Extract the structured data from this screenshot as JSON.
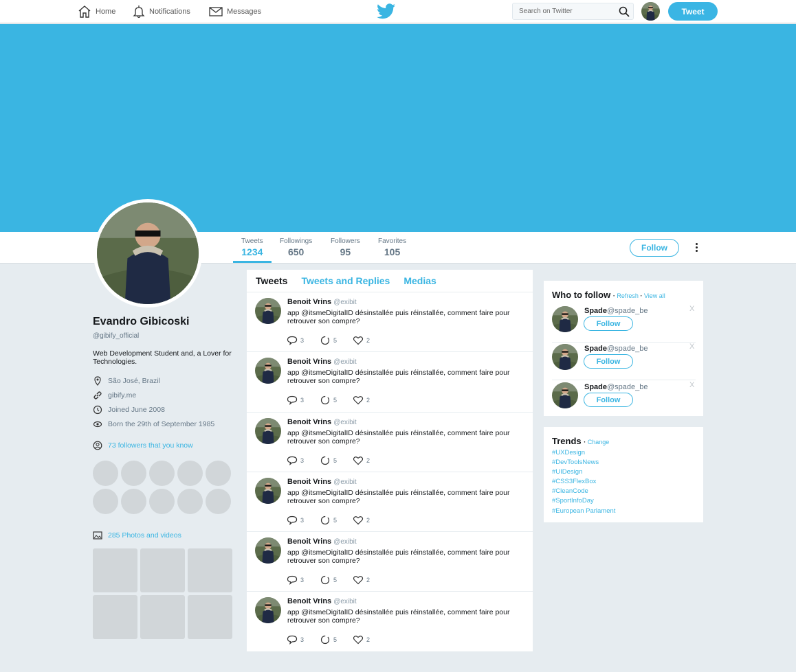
{
  "nav": {
    "home": "Home",
    "notifications": "Notifications",
    "messages": "Messages",
    "search_placeholder": "Search on Twitter",
    "tweet_button": "Tweet"
  },
  "profile_nav": {
    "stats": [
      {
        "label": "Tweets",
        "value": "1234"
      },
      {
        "label": "Followings",
        "value": "650"
      },
      {
        "label": "Followers",
        "value": "95"
      },
      {
        "label": "Favorites",
        "value": "105"
      }
    ],
    "follow_button": "Follow"
  },
  "profile": {
    "name": "Evandro Gibicoski",
    "handle": "@gibify_official",
    "bio": "Web Development Student and, a Lover for Technologies.",
    "location": "São José, Brazil",
    "website": "gibify.me",
    "joined": "Joined June 2008",
    "born": "Born the 29th of September 1985",
    "followers_you_know": "73 followers that you know",
    "photos_videos": "285 Photos and videos"
  },
  "timeline": {
    "tabs": [
      "Tweets",
      "Tweets and Replies",
      "Medias"
    ],
    "tweets": [
      {
        "author": "Benoit Vrins",
        "handle": "@exibit",
        "text": "app @itsmeDigitalID désinstallée puis réinstallée, comment faire pour retrouver son compre?",
        "replies": "3",
        "retweets": "5",
        "likes": "2"
      },
      {
        "author": "Benoit Vrins",
        "handle": "@exibit",
        "text": "app @itsmeDigitalID désinstallée puis réinstallée, comment faire pour retrouver son compre?",
        "replies": "3",
        "retweets": "5",
        "likes": "2"
      },
      {
        "author": "Benoit Vrins",
        "handle": "@exibit",
        "text": "app @itsmeDigitalID désinstallée puis réinstallée, comment faire pour retrouver son compre?",
        "replies": "3",
        "retweets": "5",
        "likes": "2"
      },
      {
        "author": "Benoit Vrins",
        "handle": "@exibit",
        "text": "app @itsmeDigitalID désinstallée puis réinstallée, comment faire pour retrouver son compre?",
        "replies": "3",
        "retweets": "5",
        "likes": "2"
      },
      {
        "author": "Benoit Vrins",
        "handle": "@exibit",
        "text": "app @itsmeDigitalID désinstallée puis réinstallée, comment faire pour retrouver son compre?",
        "replies": "3",
        "retweets": "5",
        "likes": "2"
      },
      {
        "author": "Benoit Vrins",
        "handle": "@exibit",
        "text": "app @itsmeDigitalID désinstallée puis réinstallée, comment faire pour retrouver son compre?",
        "replies": "3",
        "retweets": "5",
        "likes": "2"
      }
    ]
  },
  "who_to_follow": {
    "title": "Who to follow",
    "refresh": "Refresh",
    "view_all": "View all",
    "dot": "·",
    "suggestions": [
      {
        "name": "Spade",
        "handle": "@spade_be",
        "button": "Follow",
        "close": "X"
      },
      {
        "name": "Spade",
        "handle": "@spade_be",
        "button": "Follow",
        "close": "X"
      },
      {
        "name": "Spade",
        "handle": "@spade_be",
        "button": "Follow",
        "close": "X"
      }
    ]
  },
  "trends": {
    "title": "Trends",
    "change": "Change",
    "dot": "·",
    "items": [
      "#UXDesign",
      "#DevToolsNews",
      "#UIDesign",
      "#CSS3FlexBox",
      "#CleanCode",
      "#SportInfoDay",
      "#European Parlament"
    ]
  },
  "colors": {
    "accent": "#3ab5e2",
    "background": "#e6ecf0",
    "placeholder_gray": "#d1d6d9"
  }
}
